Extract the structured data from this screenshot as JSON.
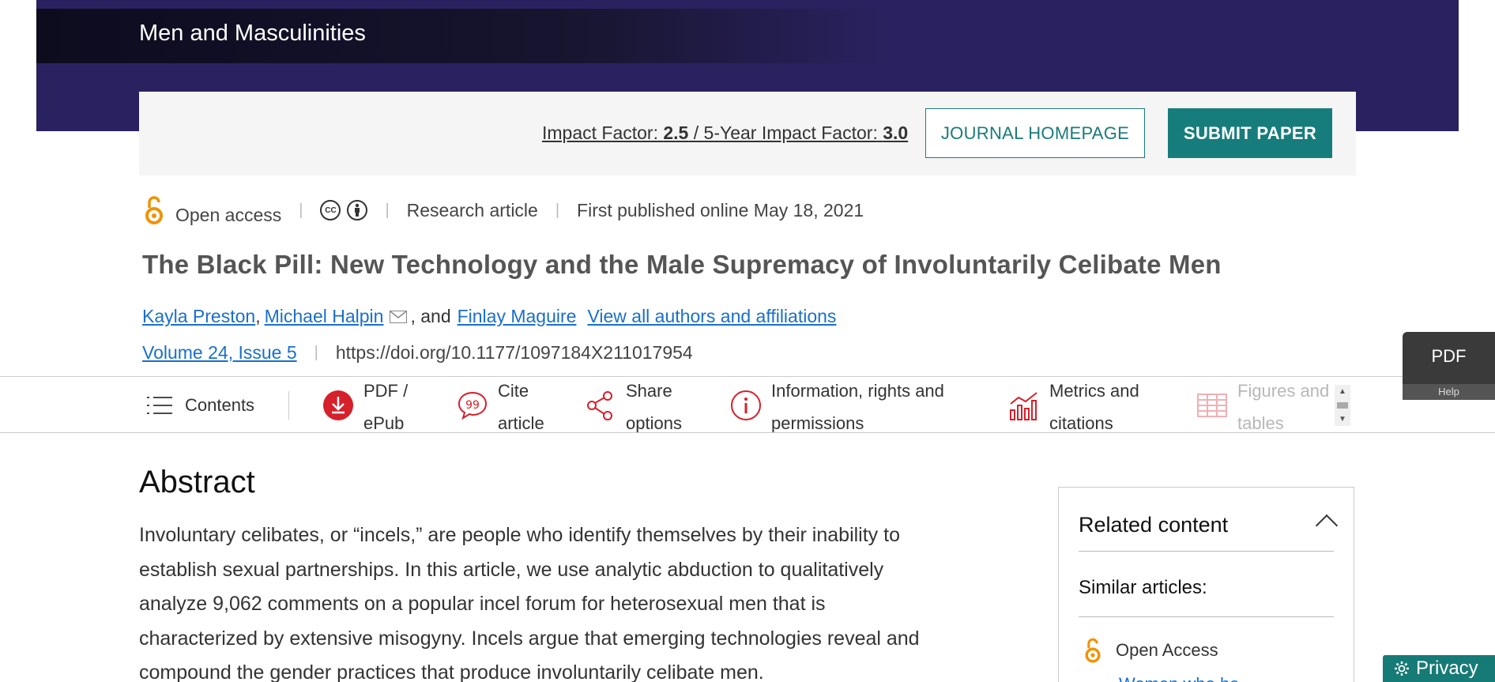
{
  "header": {
    "journal_name": "Men and Masculinities",
    "impact_label": "Impact Factor:",
    "impact_value": "2.5",
    "impact_sep": " / ",
    "five_year_label": "5-Year Impact Factor:",
    "five_year_value": "3.0",
    "journal_homepage_label": "JOURNAL HOMEPAGE",
    "submit_paper_label": "SUBMIT PAPER"
  },
  "meta": {
    "open_access": "Open access",
    "cc_icon": "CC",
    "article_type": "Research article",
    "published": "First published online May 18, 2021"
  },
  "article": {
    "title": "The Black Pill: New Technology and the Male Supremacy of Involuntarily Celibate Men",
    "authors": [
      "Kayla Preston",
      "Michael Halpin",
      "Finlay Maguire"
    ],
    "comma": ",",
    "and_text": ", and",
    "view_all": "View all authors and affiliations",
    "volume": "Volume 24, Issue 5",
    "doi": "https://doi.org/10.1177/1097184X211017954"
  },
  "toolbar": {
    "contents": "Contents",
    "pdf_line1": "PDF /",
    "pdf_line2": "ePub",
    "cite_line1": "Cite",
    "cite_line2": "article",
    "share_line1": "Share",
    "share_line2": "options",
    "info_line1": "Information, rights and",
    "info_line2": "permissions",
    "metrics_line1": "Metrics and",
    "metrics_line2": "citations",
    "figures_line1": "Figures and",
    "figures_line2": "tables"
  },
  "pdf_float": {
    "label": "PDF",
    "help": "Help"
  },
  "abstract": {
    "heading": "Abstract",
    "text": "Involuntary celibates, or “incels,” are people who identify themselves by their inability to establish sexual partnerships. In this article, we use analytic abduction to qualitatively analyze 9,062 comments on a popular incel forum for heterosexual men that is characterized by extensive misogyny. Incels argue that emerging technologies reveal and compound the gender practices that produce involuntarily celibate men."
  },
  "related": {
    "heading": "Related content",
    "similar": "Similar articles:",
    "open_access": "Open Access",
    "link_partial": "Women who ha"
  },
  "privacy": {
    "label": "Privacy"
  },
  "colors": {
    "hero": "#2a2260",
    "teal": "#177d7c",
    "oa_orange": "#f29200",
    "tool_red": "#d6202b",
    "link": "#1a6fc9"
  }
}
